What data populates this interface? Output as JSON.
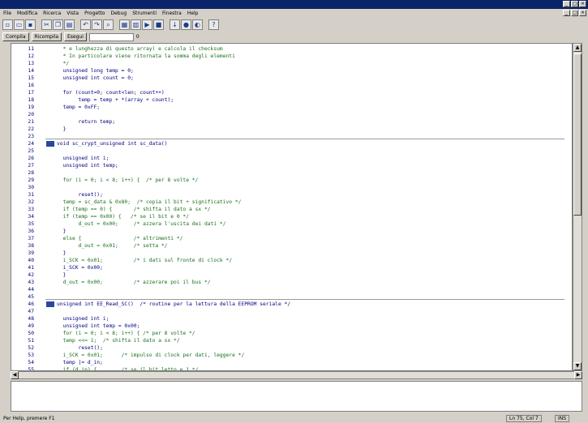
{
  "window": {
    "title_buttons": [
      "_",
      "□",
      "×"
    ]
  },
  "menu": {
    "items": [
      "File",
      "Modifica",
      "Ricerca",
      "Vista",
      "Progetto",
      "Debug",
      "Strumenti",
      "Finestra",
      "Help"
    ]
  },
  "toolbar": {
    "buttons": [
      "new",
      "open",
      "save",
      "cut",
      "copy",
      "paste",
      "undo",
      "redo",
      "find",
      "compile",
      "build",
      "run",
      "stop",
      "step",
      "breakpoint",
      "watch",
      "help"
    ]
  },
  "commands": {
    "btn1": "Compila",
    "btn2": "Ricompila",
    "btn3": "Esegui",
    "field_value": "",
    "counter": "0"
  },
  "code_lines": [
    {
      "n": "11",
      "g": "",
      "t": "  * e lunghezza di questo array) e calcola il checksum",
      "c": "cm"
    },
    {
      "n": "12",
      "g": "",
      "t": "  * In particolare viene ritornata la somma degli elementi",
      "c": "cm"
    },
    {
      "n": "13",
      "g": "",
      "t": "  */",
      "c": "cm"
    },
    {
      "n": "14",
      "g": "",
      "t": "  unsigned long temp = 0;",
      "c": "cd"
    },
    {
      "n": "15",
      "g": "",
      "t": "  unsigned int count = 0;",
      "c": "cd"
    },
    {
      "n": "16",
      "g": "",
      "t": "",
      "c": "cd"
    },
    {
      "n": "17",
      "g": "",
      "t": "  for (count=0; count<len; count++)",
      "c": "cd"
    },
    {
      "n": "18",
      "g": "",
      "t": "       temp = temp + *(array + count);",
      "c": "cd"
    },
    {
      "n": "19",
      "g": "",
      "t": "  temp = 0xFF;",
      "c": "cd"
    },
    {
      "n": "20",
      "g": "",
      "t": "",
      "c": "cd"
    },
    {
      "n": "21",
      "g": "",
      "t": "       return temp;",
      "c": "cd"
    },
    {
      "n": "22",
      "g": "",
      "t": "  }",
      "c": "cd"
    },
    {
      "n": "23",
      "g": "",
      "t": "",
      "c": "cd"
    },
    {
      "n": "24",
      "g": "",
      "t": "void sc_crypt_unsigned int sc_data()",
      "c": "kw"
    },
    {
      "n": "25",
      "g": "",
      "t": "",
      "c": "cd"
    },
    {
      "n": "26",
      "g": "",
      "t": "  unsigned int i;",
      "c": "cd"
    },
    {
      "n": "27",
      "g": "",
      "t": "  unsigned int temp;",
      "c": "cd"
    },
    {
      "n": "28",
      "g": "",
      "t": "",
      "c": "cd"
    },
    {
      "n": "29",
      "g": "",
      "t": "  for (i = 0; i < 8; i++) {  /* per 8 volte */",
      "c": "cm"
    },
    {
      "n": "30",
      "g": "",
      "t": "",
      "c": "cd"
    },
    {
      "n": "31",
      "g": "",
      "t": "       reset();",
      "c": "cd"
    },
    {
      "n": "32",
      "g": "",
      "t": "  temp = sc_data & 0x80;  /* copia il bit + significativo */",
      "c": "cm"
    },
    {
      "n": "33",
      "g": "",
      "t": "  if (temp == 0) {       /* shifta il dato a sx */",
      "c": "cm"
    },
    {
      "n": "34",
      "g": "",
      "t": "  if (temp == 0x00) {   /* se il bit e 0 */",
      "c": "cm"
    },
    {
      "n": "35",
      "g": "",
      "t": "       d_out = 0x00;     /* azzera l'uscita dei dati */",
      "c": "cm"
    },
    {
      "n": "36",
      "g": "",
      "t": "  }",
      "c": "cd"
    },
    {
      "n": "37",
      "g": "",
      "t": "  else {                 /* altrimenti */",
      "c": "cm"
    },
    {
      "n": "38",
      "g": "",
      "t": "       d_out = 0x01;     /* setta */",
      "c": "cm"
    },
    {
      "n": "39",
      "g": "",
      "t": "  }",
      "c": "cd"
    },
    {
      "n": "40",
      "g": "",
      "t": "  i_SCK = 0x01;          /* i dati sul fronte di clock */",
      "c": "cm"
    },
    {
      "n": "41",
      "g": "",
      "t": "  i_SCK = 0x00;",
      "c": "cd"
    },
    {
      "n": "42",
      "g": "",
      "t": "  }",
      "c": "cd"
    },
    {
      "n": "43",
      "g": "",
      "t": "  d_out = 0x00;          /* azzerare poi il bus */",
      "c": "cm"
    },
    {
      "n": "44",
      "g": "",
      "t": "",
      "c": "cd"
    },
    {
      "n": "45",
      "g": "",
      "t": "",
      "c": "cd"
    },
    {
      "n": "46",
      "g": "",
      "t": "unsigned int EE_Read_SC()  /* routine per la lettura della EEPROM seriale */",
      "c": "kw"
    },
    {
      "n": "47",
      "g": "",
      "t": "",
      "c": "cd"
    },
    {
      "n": "48",
      "g": "",
      "t": "  unsigned int i;",
      "c": "cd"
    },
    {
      "n": "49",
      "g": "",
      "t": "  unsigned int temp = 0x00;",
      "c": "cd"
    },
    {
      "n": "50",
      "g": "",
      "t": "  for (i = 0; i < 8; i++) { /* per 8 volte */",
      "c": "cm"
    },
    {
      "n": "51",
      "g": "",
      "t": "  temp <<= 1;  /* shifta il dato a sx */",
      "c": "cm"
    },
    {
      "n": "52",
      "g": "",
      "t": "       reset();",
      "c": "cd"
    },
    {
      "n": "53",
      "g": "",
      "t": "  i_SCK = 0x01;      /* impulso di clock per dati, leggere */",
      "c": "cm"
    },
    {
      "n": "54",
      "g": "",
      "t": "  temp |= d_in;",
      "c": "cd"
    },
    {
      "n": "55",
      "g": "",
      "t": "  if (d_in) {        /* se il bit letto e 1 */",
      "c": "cm"
    }
  ],
  "status": {
    "left": "Per Help, premere F1",
    "pos": "Ln 75, Col 7",
    "mode": "INS"
  },
  "colors": {
    "title_bar": "#0a246a",
    "keyword": "#000080",
    "comment": "#1a6e1a",
    "editor_bg": "#ffffff"
  }
}
